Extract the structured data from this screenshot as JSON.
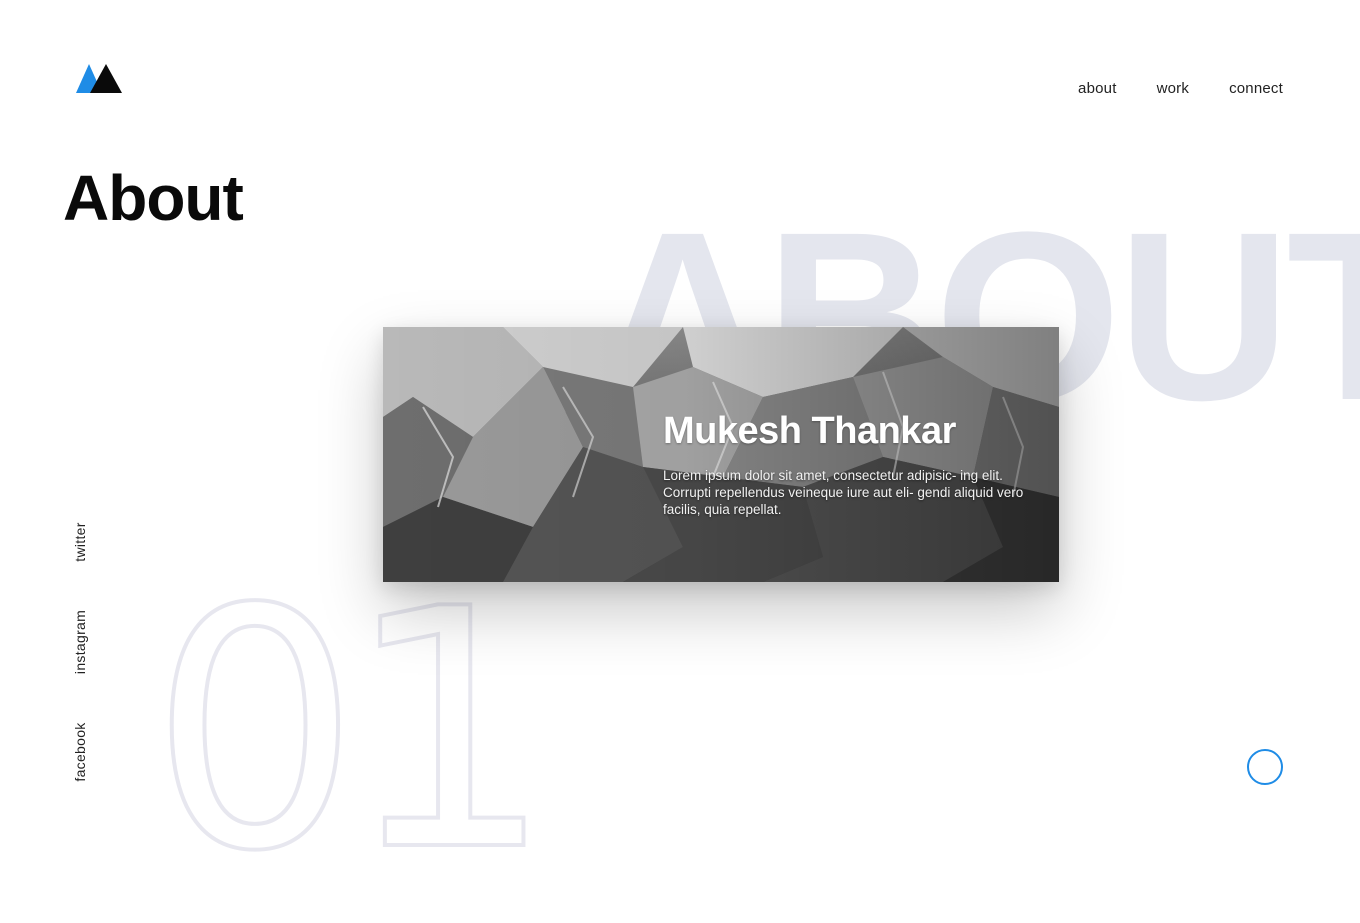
{
  "brand": {
    "accent": "#1f8ce6",
    "dark": "#0a0a0a"
  },
  "nav": {
    "items": [
      {
        "label": "about"
      },
      {
        "label": "work"
      },
      {
        "label": "connect"
      }
    ]
  },
  "page": {
    "title": "About",
    "background_word": "ABOUT",
    "background_number": "01"
  },
  "profile": {
    "name": "Mukesh Thankar",
    "description": "Lorem ipsum dolor sit amet, consectetur adipisic- ing elit. Corrupti repellendus veineque iure aut eli- gendi aliquid vero facilis, quia repellat."
  },
  "social": {
    "links": [
      {
        "label": "twitter"
      },
      {
        "label": "instagram"
      },
      {
        "label": "facebook"
      }
    ]
  }
}
